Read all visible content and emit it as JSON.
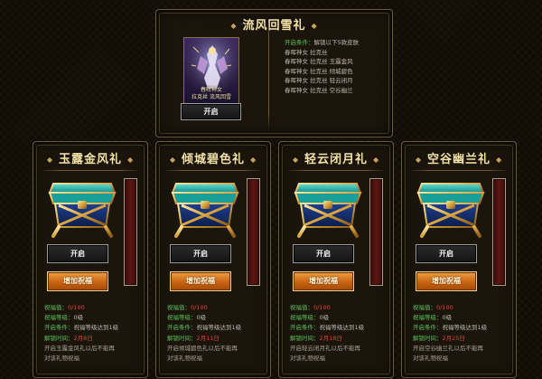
{
  "top_gift": {
    "title": "流风回雪礼",
    "thumb_caption_line1": "春晖神女",
    "thumb_caption_line2": "拉克丝 流风回雪",
    "open_label": "开启",
    "conditions": [
      {
        "label": "开启条件：",
        "value": "解锁以下5款皮肤"
      },
      {
        "label": "",
        "value": "春晖神女 拉克丝"
      },
      {
        "label": "",
        "value": "春晖神女 拉克丝 玉露金风"
      },
      {
        "label": "",
        "value": "春晖神女 拉克丝 倾城碧色"
      },
      {
        "label": "",
        "value": "春晖神女 拉克丝 轻云闭月"
      },
      {
        "label": "",
        "value": "春晖神女 拉克丝 空谷幽兰"
      }
    ]
  },
  "cards": [
    {
      "title": "玉露金风礼",
      "open_label": "开启",
      "bless_label": "增加祝福",
      "bless_value_label": "祝福值：",
      "bless_value": "0/100",
      "bless_level_label": "祝福等级：",
      "bless_level": "0级",
      "open_cond_label": "开启条件：",
      "open_cond": "祝福等级达到1级",
      "unlock_time_label": "解锁时间：",
      "unlock_time": "2月8日",
      "desc_line1": "开启玉露金风礼以后不能再",
      "desc_line2": "对该礼物祝福"
    },
    {
      "title": "倾城碧色礼",
      "open_label": "开启",
      "bless_label": "增加祝福",
      "bless_value_label": "祝福值：",
      "bless_value": "0/100",
      "bless_level_label": "祝福等级：",
      "bless_level": "0级",
      "open_cond_label": "开启条件：",
      "open_cond": "祝福等级达到1级",
      "unlock_time_label": "解锁时间：",
      "unlock_time": "2月11日",
      "desc_line1": "开启倾城碧色礼以后不能再",
      "desc_line2": "对该礼物祝福"
    },
    {
      "title": "轻云闭月礼",
      "open_label": "开启",
      "bless_label": "增加祝福",
      "bless_value_label": "祝福值：",
      "bless_value": "0/100",
      "bless_level_label": "祝福等级：",
      "bless_level": "0级",
      "open_cond_label": "开启条件：",
      "open_cond": "祝福等级达到1级",
      "unlock_time_label": "解锁时间：",
      "unlock_time": "2月18日",
      "desc_line1": "开启轻云闭月礼以后不能再",
      "desc_line2": "对该礼物祝福"
    },
    {
      "title": "空谷幽兰礼",
      "open_label": "开启",
      "bless_label": "增加祝福",
      "bless_value_label": "祝福值：",
      "bless_value": "0/100",
      "bless_level_label": "祝福等级：",
      "bless_level": "0级",
      "open_cond_label": "开启条件：",
      "open_cond": "祝福等级达到1级",
      "unlock_time_label": "解锁时间：",
      "unlock_time": "2月25日",
      "desc_line1": "开启空谷幽兰礼以后不能再",
      "desc_line2": "对该礼物祝福"
    }
  ],
  "colors": {
    "title_gold": "#f3e3a8",
    "label_green": "#5cc15a",
    "date_red": "#e1432f",
    "button_orange": "#c86414",
    "meter_red": "#5d1610"
  },
  "icons": {
    "chest": "treasure-chest-icon",
    "title_ornament": "diamond-dot-icon"
  }
}
